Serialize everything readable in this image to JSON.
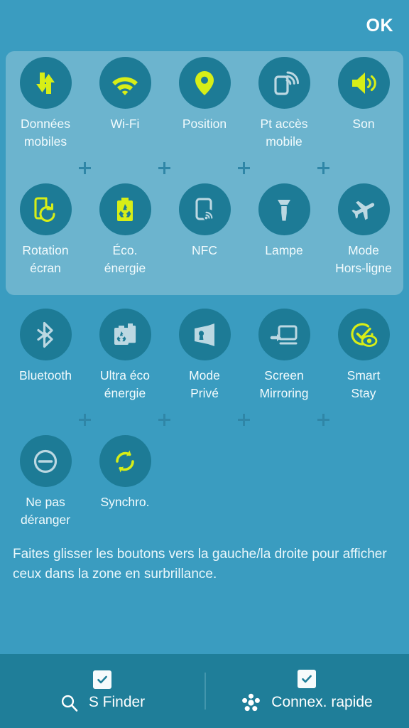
{
  "header": {
    "ok_label": "OK"
  },
  "colors": {
    "background": "#3a9cc0",
    "highlight_panel": "#6cb4ce",
    "tile_circle": "#1d7b96",
    "accent_active": "#d7ee17",
    "icon_inactive": "#bcd8e2",
    "bottom_bar": "#1f7e99",
    "text": "#f2fbfd"
  },
  "panel": {
    "highlighted_rows": [
      0,
      1
    ]
  },
  "rows": [
    {
      "index": 0,
      "in_highlight": true,
      "tiles": [
        {
          "label": "Données\nmobiles",
          "icon": "mobile-data-icon",
          "state": "on"
        },
        {
          "label": "Wi-Fi",
          "icon": "wifi-icon",
          "state": "on"
        },
        {
          "label": "Position",
          "icon": "location-pin-icon",
          "state": "on"
        },
        {
          "label": "Pt accès\nmobile",
          "icon": "mobile-hotspot-icon",
          "state": "off"
        },
        {
          "label": "Son",
          "icon": "sound-speaker-icon",
          "state": "on"
        }
      ]
    },
    {
      "index": 1,
      "in_highlight": true,
      "tiles": [
        {
          "label": "Rotation\nécran",
          "icon": "screen-rotation-icon",
          "state": "on"
        },
        {
          "label": "Éco.\nénergie",
          "icon": "power-saving-battery-icon",
          "state": "on"
        },
        {
          "label": "NFC",
          "icon": "nfc-icon",
          "state": "off"
        },
        {
          "label": "Lampe",
          "icon": "flashlight-icon",
          "state": "off"
        },
        {
          "label": "Mode\nHors-ligne",
          "icon": "airplane-icon",
          "state": "off"
        }
      ]
    },
    {
      "index": 2,
      "in_highlight": false,
      "tiles": [
        {
          "label": "Bluetooth",
          "icon": "bluetooth-icon",
          "state": "off"
        },
        {
          "label": "Ultra éco\nénergie",
          "icon": "ultra-power-saving-icon",
          "state": "off"
        },
        {
          "label": "Mode\nPrivé",
          "icon": "private-mode-lock-icon",
          "state": "off"
        },
        {
          "label": "Screen\nMirroring",
          "icon": "screen-mirroring-icon",
          "state": "off"
        },
        {
          "label": "Smart\nStay",
          "icon": "smart-stay-eye-icon",
          "state": "on"
        }
      ]
    },
    {
      "index": 3,
      "in_highlight": false,
      "tiles": [
        {
          "label": "Ne pas\ndéranger",
          "icon": "do-not-disturb-icon",
          "state": "off"
        },
        {
          "label": "Synchro.",
          "icon": "sync-icon",
          "state": "on"
        }
      ]
    }
  ],
  "plus_separators": {
    "count_per_row": 4,
    "rows": [
      0,
      2
    ]
  },
  "hint": {
    "text": "Faites glisser les boutons vers la gauche/la droite pour afficher ceux dans la zone en surbrillance."
  },
  "bottom_bar": {
    "items": [
      {
        "label": "S Finder",
        "icon": "search-icon",
        "checked": true
      },
      {
        "label": "Connex. rapide",
        "icon": "quick-connect-icon",
        "checked": true
      }
    ]
  }
}
